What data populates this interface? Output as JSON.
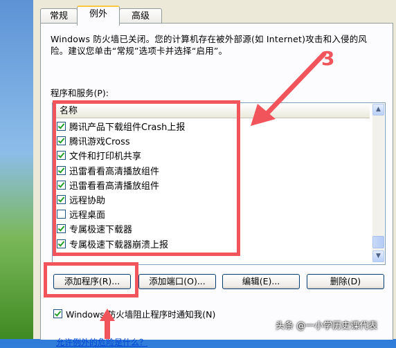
{
  "tabs": [
    "常规",
    "例外",
    "高级"
  ],
  "notice": "Windows 防火墙已关闭。您的计算机存在被外部源(如 Internet)攻击和入侵的风险。建议您单击“常规”选项卡并选择“启用”。",
  "services_label": "程序和服务(P):",
  "column_header": "名称",
  "items": [
    {
      "label": "腾讯产品下载组件Crash上报",
      "checked": true
    },
    {
      "label": "腾讯游戏Cross",
      "checked": true
    },
    {
      "label": "文件和打印机共享",
      "checked": true
    },
    {
      "label": "迅雷看看高清播放组件",
      "checked": true
    },
    {
      "label": "迅雷看看高清播放组件",
      "checked": true
    },
    {
      "label": "远程协助",
      "checked": true
    },
    {
      "label": "远程桌面",
      "checked": false
    },
    {
      "label": "专属极速下载器",
      "checked": true
    },
    {
      "label": "专属极速下载器崩溃上报",
      "checked": true
    }
  ],
  "buttons": {
    "add_program": "添加程序(R)...",
    "add_port": "添加端口(O)...",
    "edit": "编辑(E)...",
    "delete": "删除(D)"
  },
  "notify_label": "Windows 防火墙阻止程序时通知我(N)",
  "notify_checked": true,
  "cut_link": "允许例外的危险是什么？",
  "annotation_number": "3",
  "watermark": "头条 @一小学历史课代表",
  "annotation_color": "#f2545b"
}
